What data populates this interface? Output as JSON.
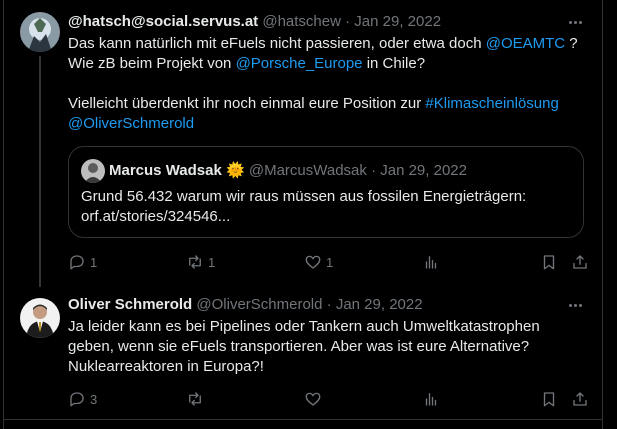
{
  "tweets": [
    {
      "name": "@hatsch@social.servus.at",
      "handle": "@hatschew",
      "dot": "·",
      "date": "Jan 29, 2022",
      "text": {
        "l1": "Das kann natürlich mit eFuels nicht passieren, oder etwa doch ",
        "l1_link": "@OEAMTC",
        "l1_end": " ?",
        "l2": "Wie zB beim Projekt von ",
        "l2_link": "@Porsche_Europe",
        "l2_end": " in Chile?",
        "l4": "Vielleicht überdenkt ihr noch einmal eure Position zur ",
        "l4_link": "#Klimascheinlösung",
        "l5_link": "@OliverSchmerold"
      },
      "quote": {
        "name": "Marcus Wadsak",
        "emoji": "🌞",
        "handle": "@MarcusWadsak",
        "dot": "·",
        "date": "Jan 29, 2022",
        "line1": "Grund 56.432 warum wir raus müssen aus fossilen Energieträgern:",
        "line2": "orf.at/stories/324546..."
      },
      "actions": {
        "replies": "1",
        "retweets": "1",
        "likes": "1"
      }
    },
    {
      "name": "Oliver Schmerold",
      "handle": "@OliverSchmerold",
      "dot": "·",
      "date": "Jan 29, 2022",
      "text": {
        "l1": "Ja leider kann es bei Pipelines oder Tankern auch Umweltkatastrophen",
        "l2": "geben, wenn sie eFuels transportieren. Aber was ist eure Alternative?",
        "l3": "Nuklearreaktoren in Europa?!"
      },
      "actions": {
        "replies": "3"
      }
    }
  ],
  "colors": {
    "background": "#000000",
    "text": "#e7e9ea",
    "muted": "#71767b",
    "link": "#1d9bf0",
    "border": "#2f3336"
  },
  "icons": [
    "reply-icon",
    "retweet-icon",
    "like-icon",
    "views-icon",
    "bookmark-icon",
    "share-icon",
    "more-icon"
  ]
}
